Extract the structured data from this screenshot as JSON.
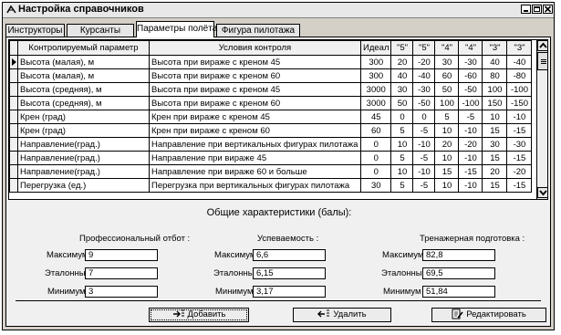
{
  "window": {
    "title": "Настройка справочников"
  },
  "tabs": [
    {
      "label": "Инструкторы"
    },
    {
      "label": "Курсанты"
    },
    {
      "label": "Параметры полёта"
    },
    {
      "label": "Фигура пилотажа"
    }
  ],
  "table": {
    "headers": [
      "Контролируемый параметр",
      "Условия контроля",
      "Идеал",
      "\"5\"",
      "\"5\"",
      "\"4\"",
      "\"4\"",
      "\"3\"",
      "\"3\""
    ],
    "rows": [
      [
        "Высота (малая), м",
        "Высота при вираже с креном 45",
        "300",
        "20",
        "-20",
        "30",
        "-30",
        "40",
        "-40"
      ],
      [
        "Высота (малая), м",
        "Высота при вираже с креном 60",
        "300",
        "40",
        "-40",
        "60",
        "-60",
        "80",
        "-80"
      ],
      [
        "Высота (средняя), м",
        "Высота при вираже с креном 45",
        "3000",
        "30",
        "-30",
        "50",
        "-50",
        "100",
        "-100"
      ],
      [
        "Высота (средняя), м",
        "Высота при вираже с креном 60",
        "3000",
        "50",
        "-50",
        "100",
        "-100",
        "150",
        "-150"
      ],
      [
        "Крен (град)",
        "Крен при вираже с креном 45",
        "45",
        "0",
        "0",
        "5",
        "-5",
        "10",
        "-10"
      ],
      [
        "Крен (град)",
        "Крен при вираже с креном 60",
        "60",
        "5",
        "-5",
        "10",
        "-10",
        "15",
        "-15"
      ],
      [
        "Направление(град.)",
        "Направление при вертикальных фигурах пилотажа",
        "0",
        "10",
        "-10",
        "20",
        "-20",
        "30",
        "-30"
      ],
      [
        "Направление(град.)",
        "Направление при вираже 45",
        "0",
        "5",
        "-5",
        "10",
        "-10",
        "15",
        "-15"
      ],
      [
        "Направление(град.)",
        "Направление при вираже 60 и больше",
        "0",
        "10",
        "-10",
        "15",
        "-15",
        "20",
        "-20"
      ],
      [
        "Перегрузка (ед.)",
        "Перегрузка при вертикальных фигурах пилотажа",
        "30",
        "5",
        "-5",
        "10",
        "-10",
        "15",
        "-15"
      ]
    ]
  },
  "general": {
    "title": "Общие характеристики (балы):",
    "groups": [
      {
        "title": "Профессиональный отбот :",
        "max_label": "Максимум :",
        "max": "9",
        "ref_label": "Эталонный :",
        "ref": "7",
        "min_label": "Минимум :",
        "min": "3"
      },
      {
        "title": "Успеваемость :",
        "max_label": "Максимум :",
        "max": "6,6",
        "ref_label": "Эталонный :",
        "ref": "6,15",
        "min_label": "Минимум :",
        "min": "3,17"
      },
      {
        "title": "Тренажерная подготовка :",
        "max_label": "Максимум :",
        "max": "82,8",
        "ref_label": "Эталонный :",
        "ref": "69,5",
        "min_label": "Минимум :",
        "min": "51,84"
      }
    ]
  },
  "buttons": {
    "add": "Добавить",
    "delete": "Удалить",
    "edit": "Редактировать"
  }
}
